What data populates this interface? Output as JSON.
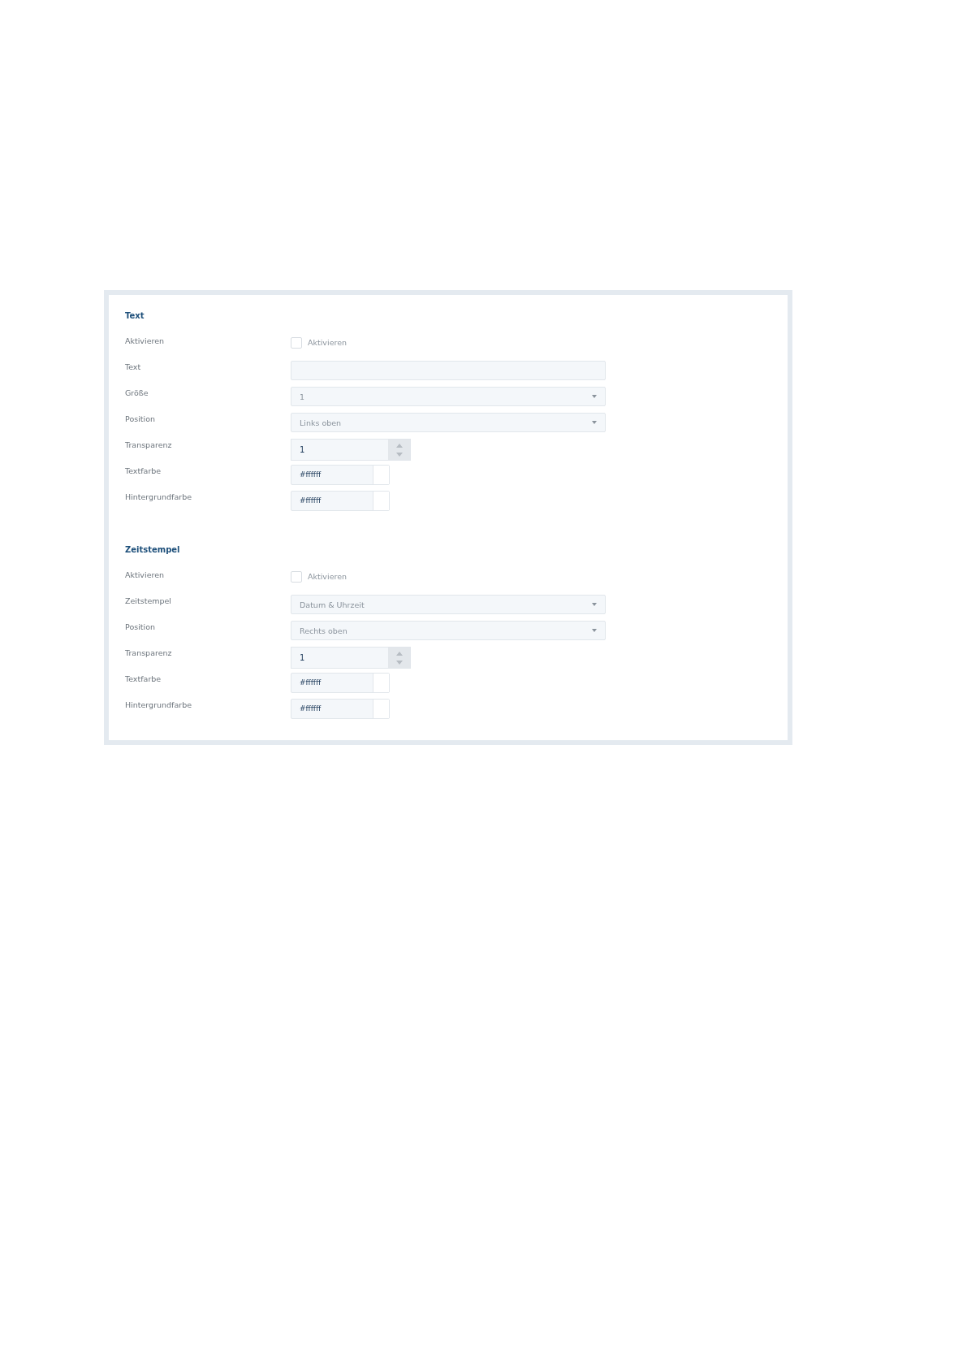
{
  "sections": [
    {
      "title": "Text",
      "rows": [
        {
          "label": "Aktivieren",
          "kind": "checkbox",
          "checked": false,
          "text": "Aktivieren"
        },
        {
          "label": "Text",
          "kind": "text"
        },
        {
          "label": "Größe",
          "kind": "select",
          "value": "1"
        },
        {
          "label": "Position",
          "kind": "select",
          "value": "Links oben"
        },
        {
          "label": "Transparenz",
          "kind": "number",
          "value": "1"
        },
        {
          "label": "Textfarbe",
          "kind": "color",
          "value": "#ffffff",
          "color": "#ffffff"
        },
        {
          "label": "Hintergrundfarbe",
          "kind": "color",
          "value": "#ffffff",
          "color": "#ffffff"
        }
      ]
    },
    {
      "title": "Zeitstempel",
      "rows": [
        {
          "label": "Aktivieren",
          "kind": "checkbox",
          "checked": false,
          "text": "Aktivieren"
        },
        {
          "label": "Zeitstempel",
          "kind": "select",
          "value": "Datum & Uhrzeit"
        },
        {
          "label": "Position",
          "kind": "select",
          "value": "Rechts oben"
        },
        {
          "label": "Transparenz",
          "kind": "number",
          "value": "1"
        },
        {
          "label": "Textfarbe",
          "kind": "color",
          "value": "#ffffff",
          "color": "#ffffff"
        },
        {
          "label": "Hintergrundfarbe",
          "kind": "color",
          "value": "#ffffff",
          "color": "#ffffff"
        }
      ]
    }
  ]
}
